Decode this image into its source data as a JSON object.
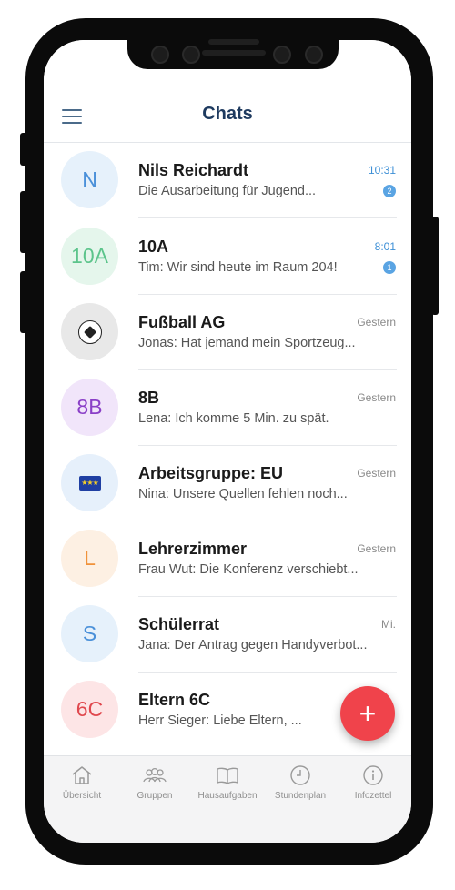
{
  "header": {
    "title": "Chats"
  },
  "chats": [
    {
      "avatar": "N",
      "avatar_color": "#4a90d9",
      "avatar_bg": "#e6f1fb",
      "name": "Nils Reichardt",
      "preview": "Die Ausarbeitung für Jugend...",
      "time": "10:31",
      "unread": "2"
    },
    {
      "avatar": "10A",
      "avatar_color": "#5cc48b",
      "avatar_bg": "#e5f6ec",
      "name": "10A",
      "preview": "Tim: Wir sind heute im Raum 204!",
      "time": "8:01",
      "unread": "1"
    },
    {
      "avatar": "soccer-ball",
      "avatar_color": "#222222",
      "avatar_bg": "#e8e8e8",
      "name": "Fußball AG",
      "preview": "Jonas: Hat jemand mein Sportzeug...",
      "time": "Gestern"
    },
    {
      "avatar": "8B",
      "avatar_color": "#8a3fc7",
      "avatar_bg": "#f1e5fa",
      "name": "8B",
      "preview": "Lena: Ich komme 5 Min. zu spät.",
      "time": "Gestern"
    },
    {
      "avatar": "eu-flag",
      "avatar_color": "#1f3fa3",
      "avatar_bg": "#e6f0fb",
      "name": "Arbeitsgruppe: EU",
      "preview": "Nina: Unsere Quellen fehlen noch...",
      "time": "Gestern"
    },
    {
      "avatar": "L",
      "avatar_color": "#f0923a",
      "avatar_bg": "#fdf0e3",
      "name": "Lehrerzimmer",
      "preview": "Frau Wut: Die Konferenz verschiebt...",
      "time": "Gestern"
    },
    {
      "avatar": "S",
      "avatar_color": "#4a90d9",
      "avatar_bg": "#e6f1fb",
      "name": "Schülerrat",
      "preview": "Jana: Der Antrag gegen Handyverbot...",
      "time": "Mi."
    },
    {
      "avatar": "6C",
      "avatar_color": "#e0484e",
      "avatar_bg": "#fde5e6",
      "name": "Eltern 6C",
      "preview": "Herr Sieger: Liebe Eltern, ...",
      "time": ""
    }
  ],
  "fab": {
    "label": "+",
    "color": "#f0434b"
  },
  "nav": [
    {
      "label": "Übersicht",
      "icon": "home-icon"
    },
    {
      "label": "Gruppen",
      "icon": "group-icon"
    },
    {
      "label": "Hausaufgaben",
      "icon": "book-icon"
    },
    {
      "label": "Stundenplan",
      "icon": "clock-icon"
    },
    {
      "label": "Infozettel",
      "icon": "info-icon"
    }
  ]
}
